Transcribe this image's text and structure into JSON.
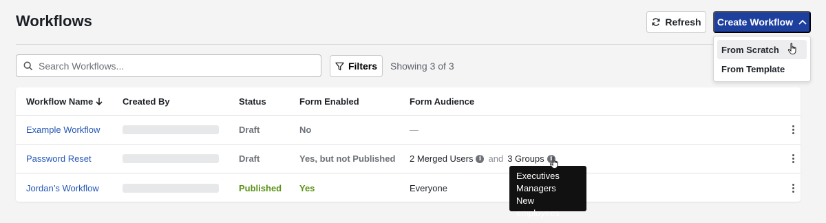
{
  "header": {
    "title": "Workflows",
    "refresh_label": "Refresh",
    "create_label": "Create Workflow"
  },
  "create_menu": {
    "items": [
      "From Scratch",
      "From Template"
    ]
  },
  "toolbar": {
    "search_placeholder": "Search Workflows...",
    "filters_label": "Filters",
    "showing_text": "Showing 3 of 3"
  },
  "table": {
    "columns": {
      "name": "Workflow Name",
      "created_by": "Created By",
      "status": "Status",
      "form_enabled": "Form Enabled",
      "form_audience": "Form Audience"
    },
    "rows": [
      {
        "name": "Example Workflow",
        "status": "Draft",
        "form_enabled": "No",
        "audience_text": "—"
      },
      {
        "name": "Password Reset",
        "status": "Draft",
        "form_enabled": "Yes, but not Published",
        "audience_users": "2 Merged Users",
        "audience_and": "and",
        "audience_groups": "3 Groups"
      },
      {
        "name": "Jordan’s Workflow",
        "status": "Published",
        "form_enabled": "Yes",
        "audience_text": "Everyone"
      }
    ]
  },
  "groups_tooltip": {
    "lines": [
      "Executives",
      "Managers",
      "New employees"
    ]
  },
  "colors": {
    "primary": "#1d3f9e",
    "link": "#2456b5",
    "published": "#5a9216"
  },
  "icons": [
    "refresh-icon",
    "chevron-up-icon",
    "search-icon",
    "filter-icon",
    "sort-down-arrow-icon",
    "info-icon",
    "kebab-menu-icon",
    "hand-cursor-icon"
  ]
}
